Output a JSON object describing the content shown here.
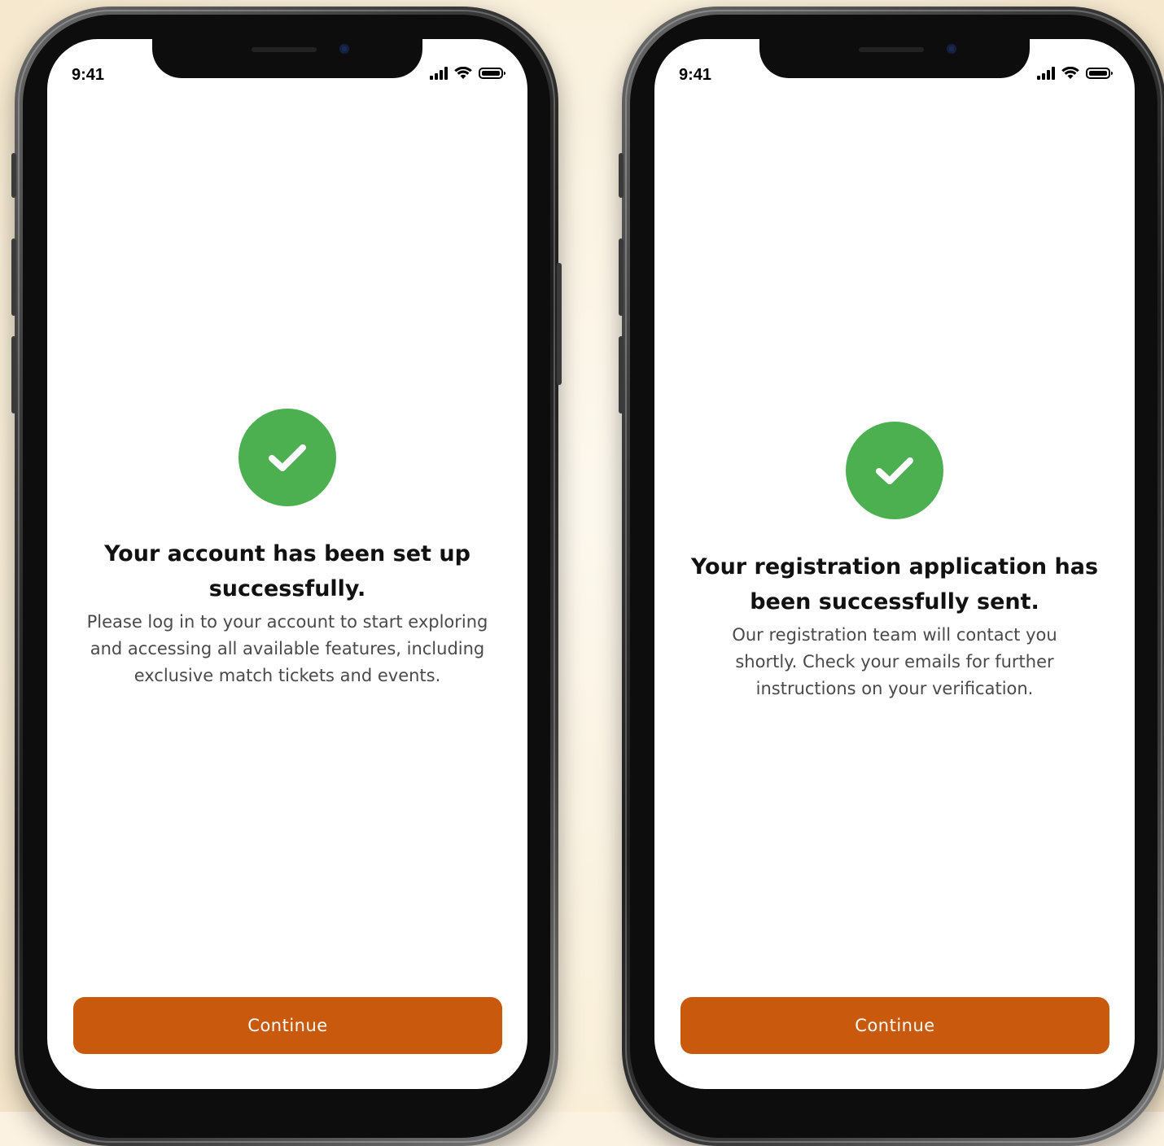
{
  "colors": {
    "background": "#fbf2e2",
    "success_green": "#4caf50",
    "button_orange": "#c9590c",
    "heading_text": "#111111",
    "body_text": "#4a4a4a"
  },
  "screens": [
    {
      "status_bar": {
        "time": "9:41",
        "icons": [
          "cellular-signal-icon",
          "wifi-icon",
          "battery-icon"
        ]
      },
      "success_icon": "checkmark-icon",
      "headline": "Your account has been set up successfully.",
      "body": "Please log in to your account to start exploring and accessing all available features, including exclusive match tickets and events.",
      "button_label": "Continue"
    },
    {
      "status_bar": {
        "time": "9:41",
        "icons": [
          "cellular-signal-icon",
          "wifi-icon",
          "battery-icon"
        ]
      },
      "success_icon": "checkmark-icon",
      "headline": "Your registration application has been successfully sent.",
      "body": "Our registration team will contact you shortly. Check your emails for further instructions on your verification.",
      "button_label": "Continue"
    }
  ]
}
